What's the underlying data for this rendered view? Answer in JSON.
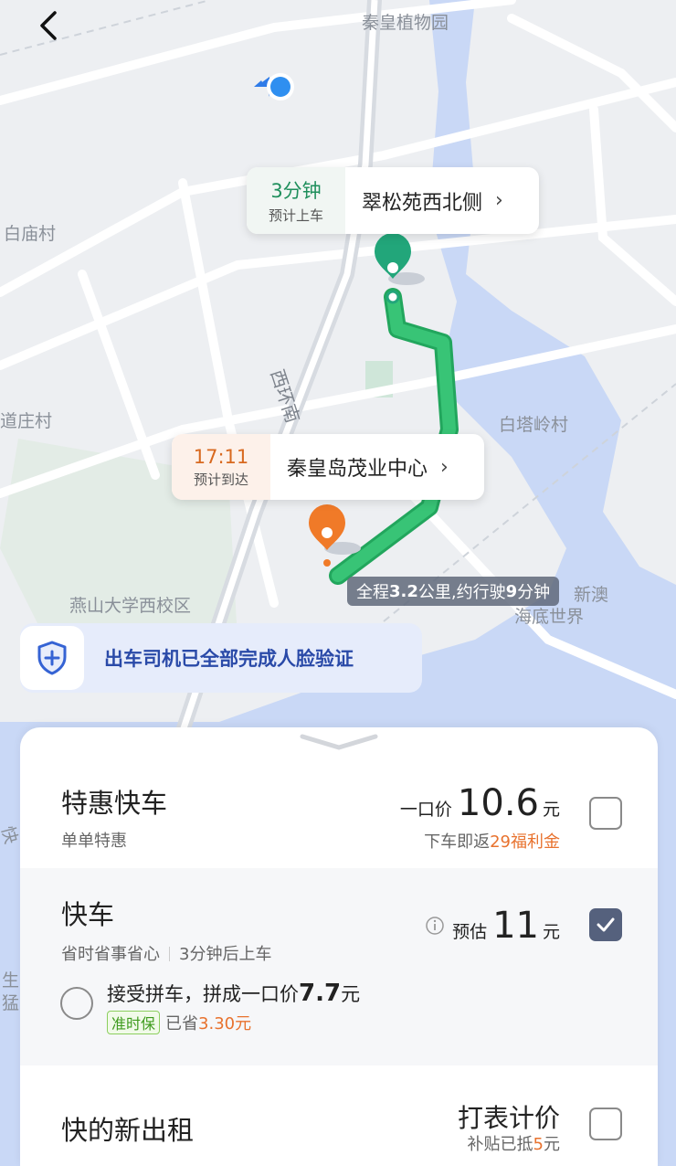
{
  "map": {
    "labels": {
      "botanical": "秦皇植物园",
      "baimiao": "白庙村",
      "daozhuang": "道庄村",
      "baita": "白塔岭村",
      "yanshan": "燕山大学西校区",
      "xinao": "新澳",
      "haidi": "海底世界",
      "xihuan": "西环南",
      "sheng": "生",
      "meng": "猛",
      "kuai": "快"
    }
  },
  "pickup": {
    "minutes": "3分钟",
    "caption": "预计上车",
    "place": "翠松苑西北侧"
  },
  "dropoff": {
    "time": "17:11",
    "caption": "预计到达",
    "place": "秦皇岛茂业中心"
  },
  "route_summary": {
    "prefix": "全程",
    "distance": "3.2",
    "mid": "公里,约行驶",
    "duration": "9",
    "suffix": "分钟"
  },
  "verify_banner": "出车司机已全部完成人脸验证",
  "options": {
    "tehui": {
      "name": "特惠快车",
      "sub": "单单特惠",
      "price_prefix": "一口价",
      "price": "10.6",
      "unit": "元",
      "note_prefix": "下车即返",
      "note_highlight": "29福利金",
      "checked": false
    },
    "kuaiche": {
      "name": "快车",
      "sub1": "省时省事省心",
      "sub2": "3分钟后上车",
      "info_icon": "info-icon",
      "price_prefix": "预估",
      "price": "11",
      "unit": "元",
      "checked": true,
      "pool": {
        "label": "接受拼车，拼成一口价",
        "price": "7.7",
        "unit": "元",
        "tag": "准时保",
        "saved_prefix": "已省",
        "saved": "3.30元"
      }
    },
    "taxi": {
      "name": "快的新出租",
      "price_label": "打表计价",
      "note_prefix": "补贴已抵",
      "note_num": "5",
      "note_unit": "元",
      "checked": false
    }
  },
  "colors": {
    "route": "#2db56b",
    "accent_orange": "#e8722e",
    "check_on": "#55617d",
    "verify_text": "#2a4aa8"
  }
}
